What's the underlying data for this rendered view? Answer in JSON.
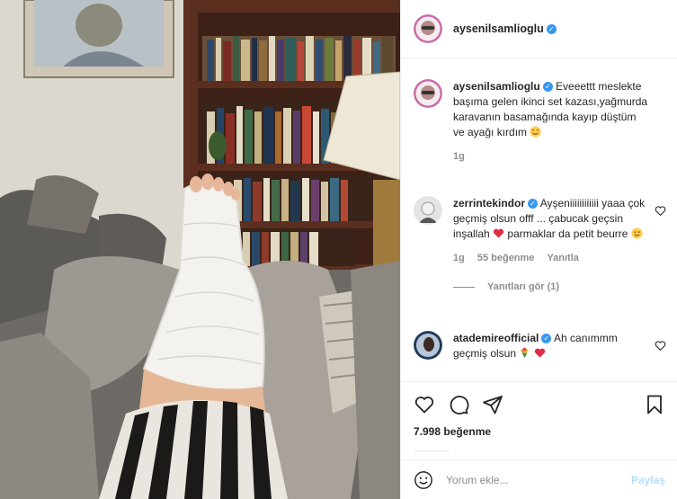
{
  "post": {
    "author": "aysenilsamlioglu",
    "author_verified": true
  },
  "caption": {
    "username": "aysenilsamlioglu",
    "text": "Eveeettt meslekte başıma gelen ikinci set kazası,yağmurda karavanın basamağında kayıp düştüm ve ayağı kırdım",
    "emoji": "smiling-face-with-heart-eyes",
    "time": "1g"
  },
  "comments": [
    {
      "username": "zerrintekindor",
      "verified": true,
      "text_a": "Ayşeniiiiiiiiiiii yaaa çok geçmiş olsun offf ... çabucak geçsin inşallah",
      "text_b": "parmaklar da petit beurre",
      "time": "1g",
      "likes": "55 beğenme",
      "reply_label": "Yanıtla",
      "view_replies": "Yanıtları gör (1)"
    },
    {
      "username": "atademireofficial",
      "verified": true,
      "text": "Ah canımmm geçmiş olsun"
    }
  ],
  "actions": {
    "likes_count": "7.998 beğenme"
  },
  "compose": {
    "placeholder": "Yorum ekle...",
    "post_label": "Paylaş"
  },
  "colors": {
    "accent": "#3897f0",
    "post_disabled": "#b2dffc",
    "heart_red": "#ed4956"
  }
}
